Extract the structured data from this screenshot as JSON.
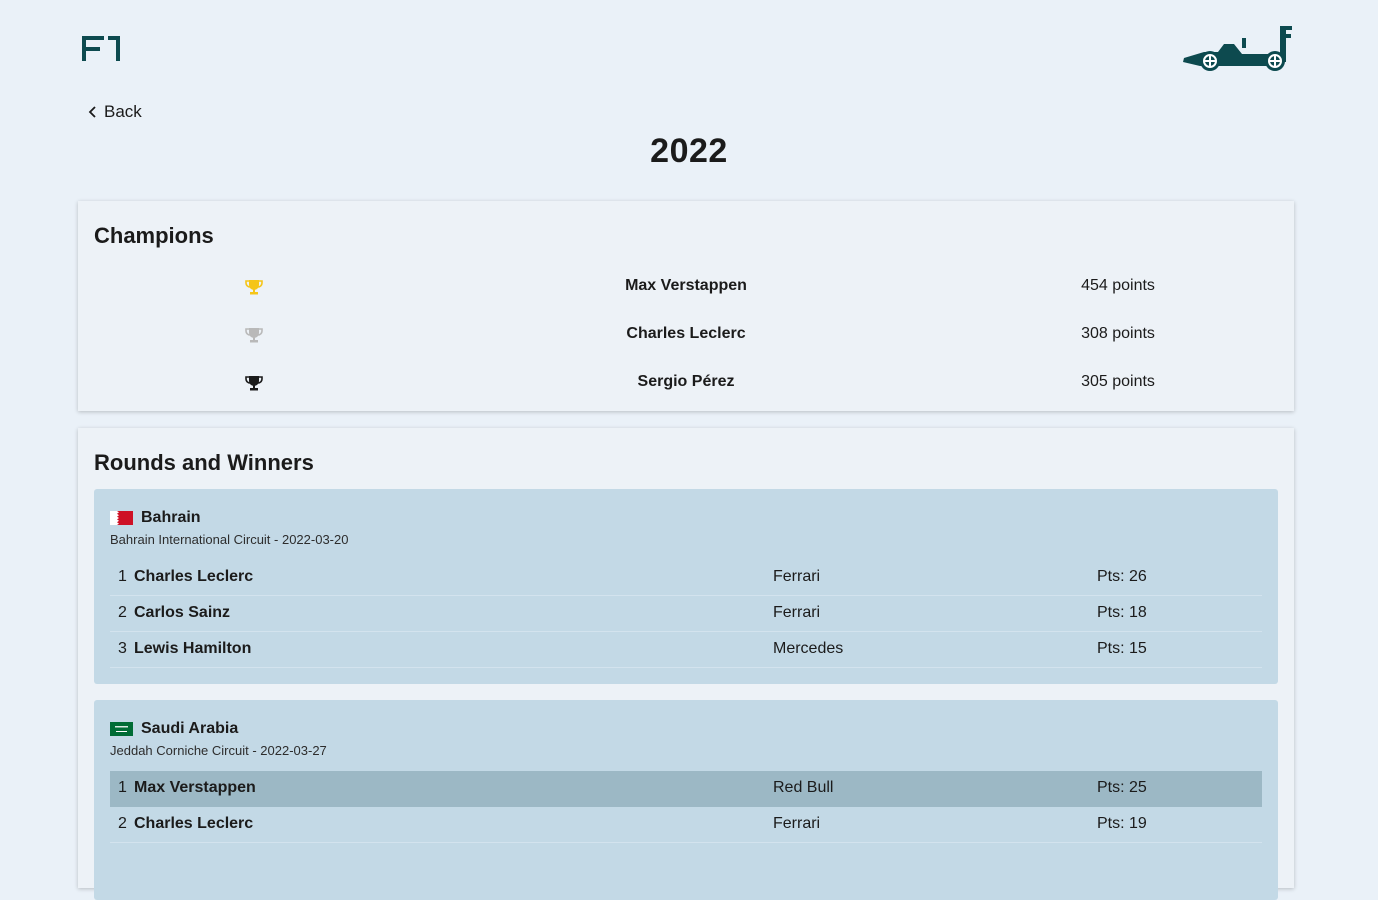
{
  "header": {
    "logo_icon": "f1-logo-icon",
    "car_icon": "race-car-icon"
  },
  "nav": {
    "back_label": "Back"
  },
  "page": {
    "title": "2022"
  },
  "champions": {
    "title": "Champions",
    "rows": [
      {
        "trophy_color": "#f5c518",
        "name": "Max Verstappen",
        "points": "454 points"
      },
      {
        "trophy_color": "#b9b9b9",
        "name": "Charles Leclerc",
        "points": "308 points"
      },
      {
        "trophy_color": "#1b1b1b",
        "name": "Sergio Pérez",
        "points": "305 points"
      }
    ]
  },
  "rounds": {
    "title": "Rounds and Winners",
    "items": [
      {
        "name": "Bahrain",
        "subtitle": "Bahrain International Circuit - 2022-03-20",
        "flag_icon": "bahrain-flag-icon",
        "results": [
          {
            "pos": "1",
            "driver": "Charles Leclerc",
            "team": "Ferrari",
            "pts": "Pts: 26"
          },
          {
            "pos": "2",
            "driver": "Carlos Sainz",
            "team": "Ferrari",
            "pts": "Pts: 18"
          },
          {
            "pos": "3",
            "driver": "Lewis Hamilton",
            "team": "Mercedes",
            "pts": "Pts: 15"
          }
        ]
      },
      {
        "name": "Saudi Arabia",
        "subtitle": "Jeddah Corniche Circuit - 2022-03-27",
        "flag_icon": "saudi-arabia-flag-icon",
        "results": [
          {
            "pos": "1",
            "driver": "Max Verstappen",
            "team": "Red Bull",
            "pts": "Pts: 25"
          },
          {
            "pos": "2",
            "driver": "Charles Leclerc",
            "team": "Ferrari",
            "pts": "Pts: 19"
          }
        ]
      }
    ]
  },
  "colors": {
    "background": "#eaf1f8",
    "brand": "#0d4a4f",
    "round_bg": "#c3d9e6",
    "highlight_row": "#9cb8c5"
  }
}
